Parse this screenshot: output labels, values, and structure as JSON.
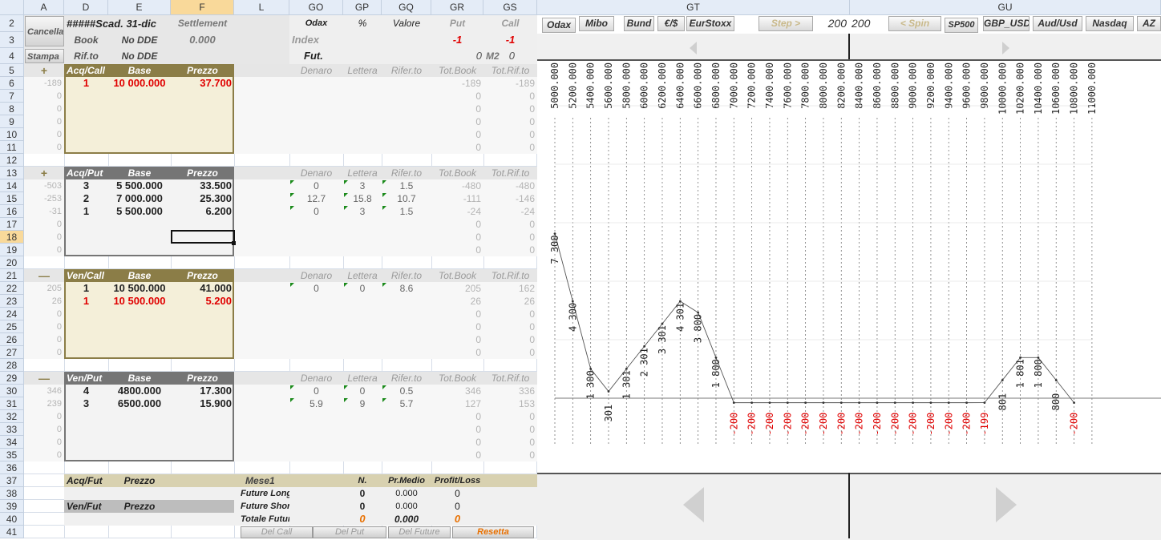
{
  "columns": [
    "A",
    "D",
    "E",
    "F",
    "L",
    "GO",
    "GP",
    "GQ",
    "GR",
    "GS",
    "GT",
    "GU"
  ],
  "rows": [
    "2",
    "3",
    "4",
    "5",
    "6",
    "7",
    "8",
    "9",
    "10",
    "11",
    "12",
    "13",
    "14",
    "15",
    "16",
    "17",
    "18",
    "19",
    "20",
    "21",
    "22",
    "23",
    "24",
    "25",
    "26",
    "27",
    "28",
    "29",
    "30",
    "31",
    "32",
    "33",
    "34",
    "35",
    "36",
    "37",
    "38",
    "39",
    "40",
    "41"
  ],
  "selected_cell": {
    "column": "F",
    "row": "18"
  },
  "top": {
    "cancella": "Cancella",
    "stampa": "Stampa",
    "scad": "#####Scad. 31-dic",
    "settlement_label": "Settlement",
    "book": "Book",
    "no_dde_1": "No DDE",
    "settlement_value": "0.000",
    "rifto": "Rif.to",
    "no_dde_2": "No DDE",
    "odax": "Odax",
    "pct": "%",
    "valore": "Valore",
    "put": "Put",
    "call": "Call",
    "index": "Index",
    "put_val": "-1",
    "call_val": "-1",
    "fut": "Fut.",
    "fut_zero": "0",
    "m2": "M2",
    "m2_val": "0"
  },
  "sections": {
    "acq_call": {
      "sign": "+",
      "title": "Acq/Call",
      "base": "Base",
      "prezzo": "Prezzo",
      "cols": [
        "Denaro",
        "Lettera",
        "Rifer.to",
        "Tot.Book",
        "Tot.Rif.to"
      ],
      "rows": [
        {
          "a": "-189",
          "d": "1",
          "e": "10 000.000",
          "f": "37.700",
          "red": true,
          "go": "",
          "gp": "",
          "gq": "",
          "gr": "-189",
          "gs": "-189"
        },
        {
          "a": "0",
          "gr": "0",
          "gs": "0"
        },
        {
          "a": "0",
          "gr": "0",
          "gs": "0"
        },
        {
          "a": "0",
          "gr": "0",
          "gs": "0"
        },
        {
          "a": "0",
          "gr": "0",
          "gs": "0"
        },
        {
          "a": "0",
          "gr": "0",
          "gs": "0"
        }
      ]
    },
    "acq_put": {
      "sign": "+",
      "title": "Acq/Put",
      "base": "Base",
      "prezzo": "Prezzo",
      "cols": [
        "Denaro",
        "Lettera",
        "Rifer.to",
        "Tot.Book",
        "Tot.Rif.to"
      ],
      "rows": [
        {
          "a": "-503",
          "d": "3",
          "e": "5 500.000",
          "f": "33.500",
          "go": "0",
          "gp": "3",
          "gq": "1.5",
          "gr": "-480",
          "gs": "-480"
        },
        {
          "a": "-253",
          "d": "2",
          "e": "7 000.000",
          "f": "25.300",
          "go": "12.7",
          "gp": "15.8",
          "gq": "10.7",
          "gr": "-111",
          "gs": "-146"
        },
        {
          "a": "-31",
          "d": "1",
          "e": "5 500.000",
          "f": "6.200",
          "go": "0",
          "gp": "3",
          "gq": "1.5",
          "gr": "-24",
          "gs": "-24"
        },
        {
          "a": "0",
          "gr": "0",
          "gs": "0"
        },
        {
          "a": "0",
          "gr": "0",
          "gs": "0"
        },
        {
          "a": "0",
          "gr": "0",
          "gs": "0"
        }
      ]
    },
    "ven_call": {
      "sign": "—",
      "title": "Ven/Call",
      "base": "Base",
      "prezzo": "Prezzo",
      "cols": [
        "Denaro",
        "Lettera",
        "Rifer.to",
        "Tot.Book",
        "Tot.Rif.to"
      ],
      "rows": [
        {
          "a": "205",
          "d": "1",
          "e": "10 500.000",
          "f": "41.000",
          "go": "0",
          "gp": "0",
          "gq": "8.6",
          "gr": "205",
          "gs": "162"
        },
        {
          "a": "26",
          "d": "1",
          "e": "10 500.000",
          "f": "5.200",
          "red": true,
          "gr": "26",
          "gs": "26"
        },
        {
          "a": "0",
          "gr": "0",
          "gs": "0"
        },
        {
          "a": "0",
          "gr": "0",
          "gs": "0"
        },
        {
          "a": "0",
          "gr": "0",
          "gs": "0"
        },
        {
          "a": "0",
          "gr": "0",
          "gs": "0"
        }
      ]
    },
    "ven_put": {
      "sign": "—",
      "title": "Ven/Put",
      "base": "Base",
      "prezzo": "Prezzo",
      "cols": [
        "Denaro",
        "Lettera",
        "Rifer.to",
        "Tot.Book",
        "Tot.Rif.to"
      ],
      "rows": [
        {
          "a": "346",
          "d": "4",
          "e": "4800.000",
          "f": "17.300",
          "go": "0",
          "gp": "0",
          "gq": "0.5",
          "gr": "346",
          "gs": "336"
        },
        {
          "a": "239",
          "d": "3",
          "e": "6500.000",
          "f": "15.900",
          "go": "5.9",
          "gp": "9",
          "gq": "5.7",
          "gr": "127",
          "gs": "153"
        },
        {
          "a": "0",
          "gr": "0",
          "gs": "0"
        },
        {
          "a": "0",
          "gr": "0",
          "gs": "0"
        },
        {
          "a": "0",
          "gr": "0",
          "gs": "0"
        },
        {
          "a": "0",
          "gr": "0",
          "gs": "0"
        }
      ]
    }
  },
  "futures": {
    "acq_fut": "Acq/Fut",
    "ven_fut": "Ven/Fut",
    "prezzo": "Prezzo",
    "prezzo2": "Prezzo",
    "mese": "Mese1",
    "n": "N.",
    "pr_medio": "Pr.Medio",
    "profit_loss": "Profit/Loss",
    "future_long": "Future Long",
    "future_short": "Future Short",
    "totale_future": "Totale Future",
    "long": {
      "n": "0",
      "pm": "0.000",
      "pl": "0"
    },
    "short": {
      "n": "0",
      "pm": "0.000",
      "pl": "0"
    },
    "total": {
      "n": "0",
      "pm": "0.000",
      "pl": "0"
    },
    "buttons": [
      "Del Call",
      "Del Put",
      "Del Future",
      "Resetta"
    ]
  },
  "toolbar": {
    "buttons": [
      "Odax",
      "Mibo",
      "Bund",
      "€/$",
      "EurStoxx"
    ],
    "step_label": "Step  >",
    "step_value": "200",
    "step_value2": "200",
    "spin_label": "< Spin",
    "buttons2": [
      "SP500",
      "GBP_USD",
      "Aud/Usd",
      "Nasdaq",
      "AZ"
    ]
  },
  "chart_data": {
    "type": "line",
    "x": [
      5000,
      5200,
      5400,
      5600,
      5800,
      6000,
      6200,
      6400,
      6600,
      6800,
      7000,
      7200,
      7400,
      7600,
      7800,
      8000,
      8200,
      8400,
      8600,
      8800,
      9000,
      9200,
      9400,
      9600,
      9800,
      10000,
      10200,
      10400,
      10600,
      10800,
      11000
    ],
    "x_labels": [
      "5000.000",
      "5200.000",
      "5400.000",
      "5600.000",
      "5800.000",
      "6000.000",
      "6200.000",
      "6400.000",
      "6600.000",
      "6800.000",
      "7000.000",
      "7200.000",
      "7400.000",
      "7600.000",
      "7800.000",
      "8000.000",
      "8200.000",
      "8400.000",
      "8600.000",
      "8800.000",
      "9000.000",
      "9200.000",
      "9400.000",
      "9600.000",
      "9800.000",
      "10000.000",
      "10200.000",
      "10400.000",
      "10600.000",
      "10800.000",
      "11000.000"
    ],
    "y": [
      7300,
      4300,
      1300,
      301,
      1301,
      2301,
      3301,
      4301,
      3800,
      1800,
      -200,
      -200,
      -200,
      -200,
      -200,
      -200,
      -200,
      -200,
      -200,
      -200,
      -200,
      -200,
      -200,
      -200,
      -199,
      801,
      1801,
      1800,
      800,
      -200
    ],
    "y_labels": [
      "7 300",
      "4 300",
      "1 300",
      "301",
      "1 301",
      "2 301",
      "3 301",
      "4 301",
      "3 800",
      "1 800",
      "-200",
      "-200",
      "-200",
      "-200",
      "-200",
      "-200",
      "-200",
      "-200",
      "-200",
      "-200",
      "-200",
      "-200",
      "-200",
      "-200",
      "-199",
      "801",
      "1 801",
      "1 800",
      "800",
      "-200"
    ],
    "negative_color": "#e00000",
    "positive_color": "#222222"
  }
}
